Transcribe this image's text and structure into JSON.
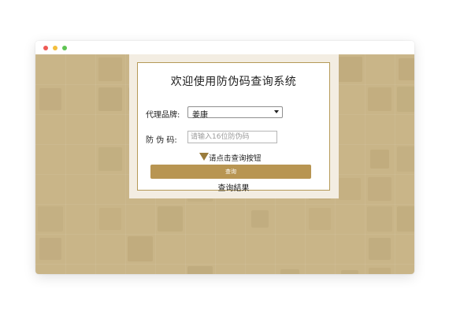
{
  "window": {
    "controls": [
      "close",
      "minimize",
      "maximize"
    ]
  },
  "panel": {
    "title": "欢迎使用防伪码查询系统",
    "brand_label": "代理品牌:",
    "brand_value": "姜康",
    "code_label": "防 伪 码:",
    "code_placeholder": "请输入16位防伪码",
    "hint_text": "请点击查询按钮",
    "search_button": "查询",
    "result_label": "查询結果"
  },
  "colors": {
    "background": "#c9b588",
    "accent": "#b89552",
    "panel_border": "#b59957"
  }
}
